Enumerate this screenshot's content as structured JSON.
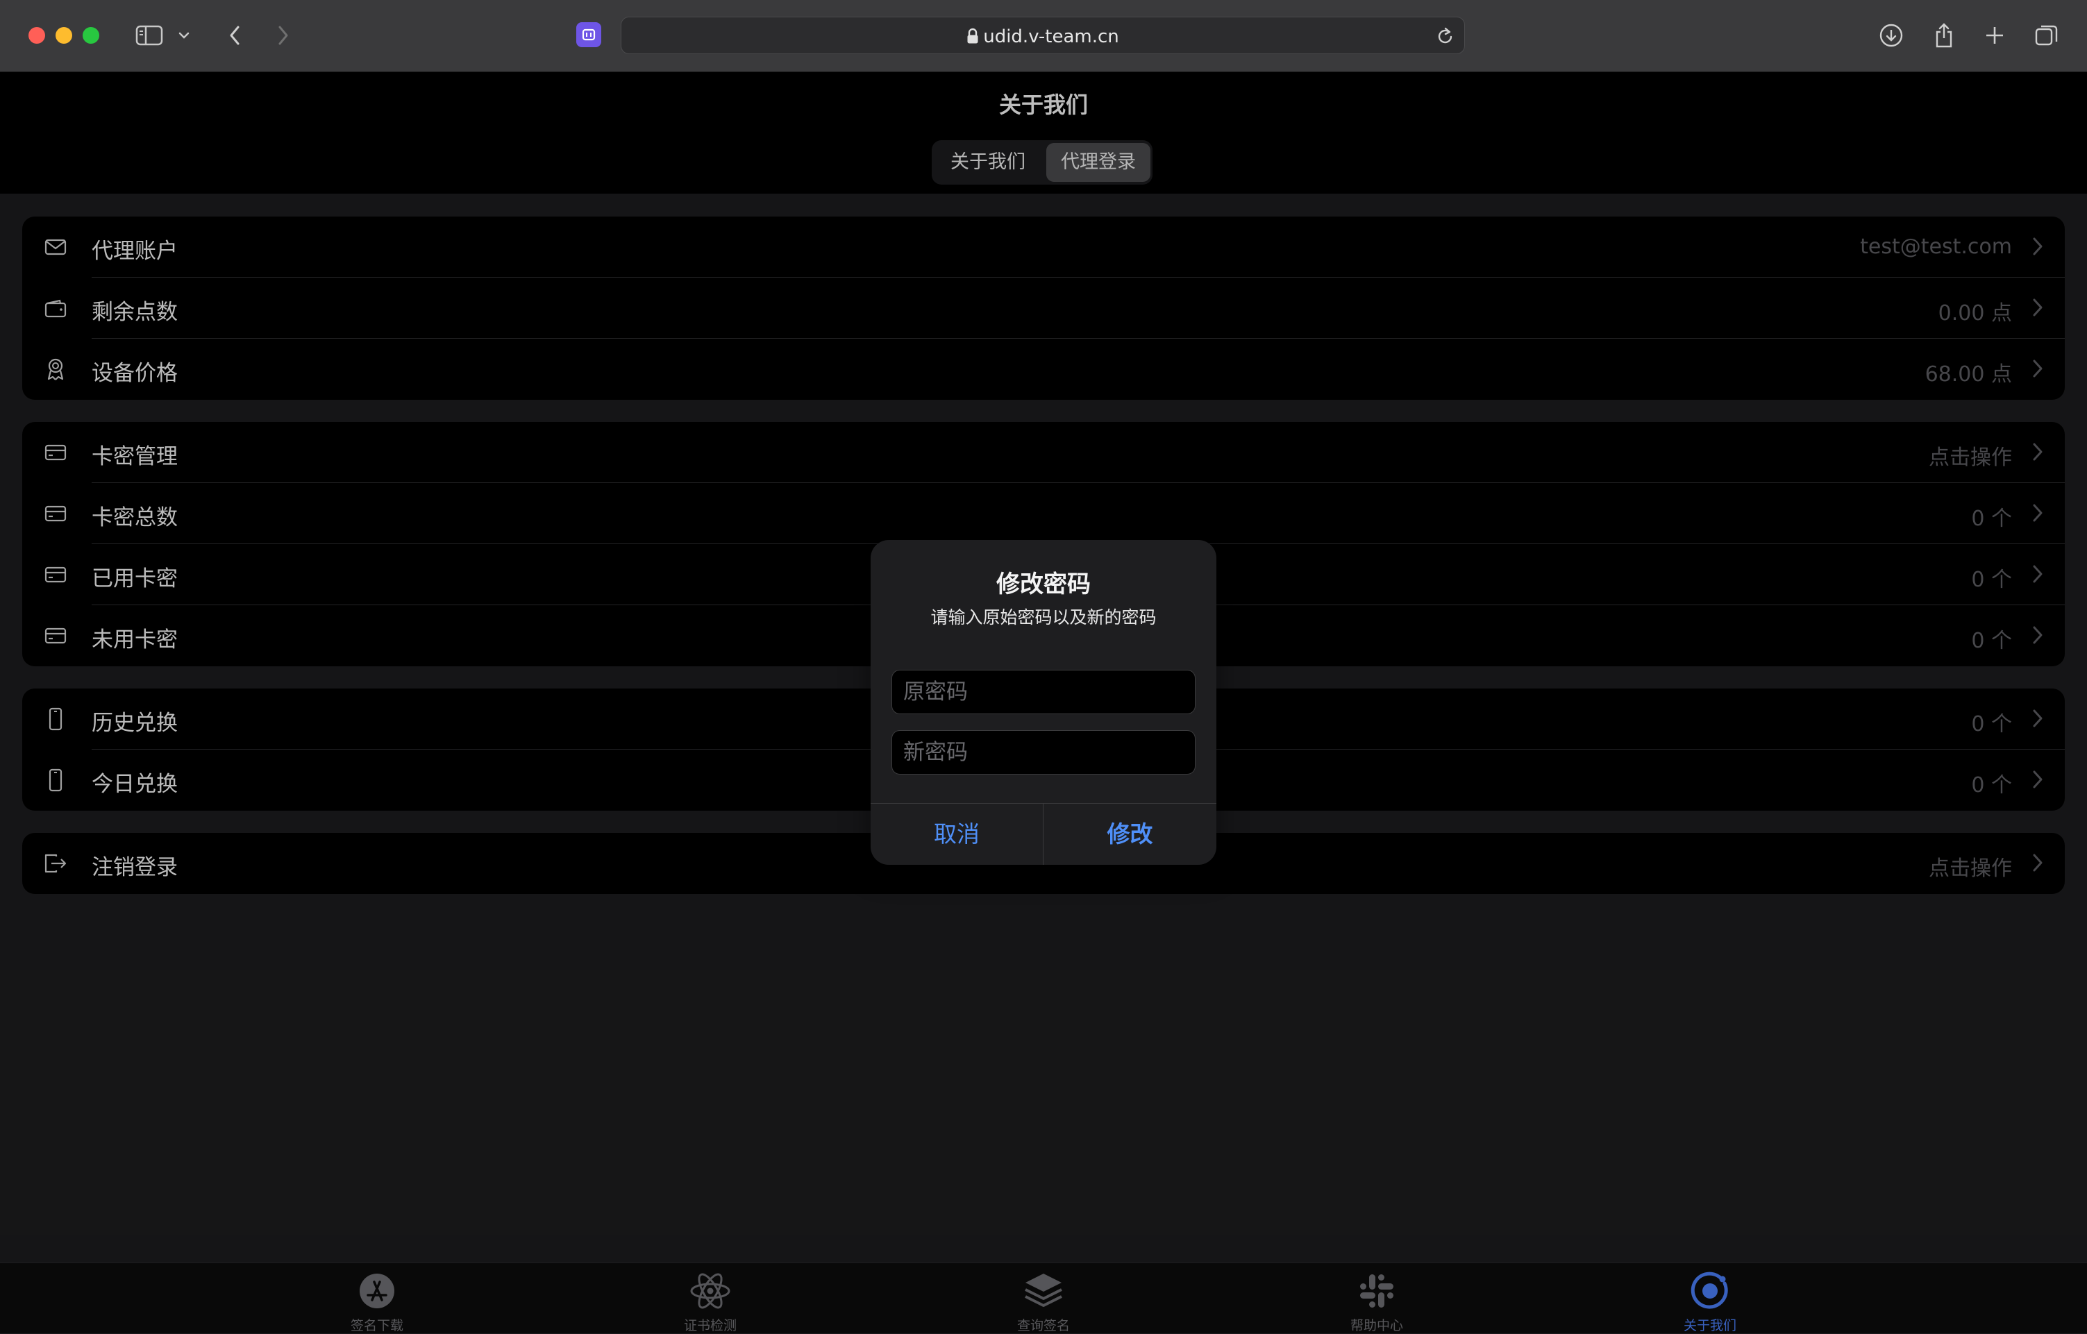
{
  "browser": {
    "url": "udid.v-team.cn"
  },
  "header": {
    "title": "关于我们",
    "segments": [
      "关于我们",
      "代理登录"
    ]
  },
  "groups": {
    "account": [
      {
        "label": "代理账户",
        "value": "test@test.com",
        "icon": "envelope-icon"
      },
      {
        "label": "剩余点数",
        "value": "0.00 点",
        "icon": "wallet-icon"
      },
      {
        "label": "设备价格",
        "value": "68.00 点",
        "icon": "award-icon"
      }
    ],
    "cards": [
      {
        "label": "卡密管理",
        "value": "点击操作",
        "icon": "card-icon"
      },
      {
        "label": "卡密总数",
        "value": "0 个",
        "icon": "card-icon"
      },
      {
        "label": "已用卡密",
        "value": "0 个",
        "icon": "card-icon"
      },
      {
        "label": "未用卡密",
        "value": "0 个",
        "icon": "card-icon"
      }
    ],
    "exchange": [
      {
        "label": "历史兑换",
        "value": "0 个",
        "icon": "phone-icon"
      },
      {
        "label": "今日兑换",
        "value": "0 个",
        "icon": "phone-icon"
      }
    ],
    "logout": [
      {
        "label": "注销登录",
        "value": "点击操作",
        "icon": "logout-icon"
      }
    ]
  },
  "dialog": {
    "title": "修改密码",
    "message": "请输入原始密码以及新的密码",
    "old_password_placeholder": "原密码",
    "new_password_placeholder": "新密码",
    "cancel_label": "取消",
    "confirm_label": "修改"
  },
  "tabbar": {
    "items": [
      {
        "label": "签名下载",
        "icon": "app-store-icon",
        "active": false
      },
      {
        "label": "证书检测",
        "icon": "atom-icon",
        "active": false
      },
      {
        "label": "查询签名",
        "icon": "layers-icon",
        "active": false
      },
      {
        "label": "帮助中心",
        "icon": "slack-icon",
        "active": false
      },
      {
        "label": "关于我们",
        "icon": "ionic-icon",
        "active": true
      }
    ],
    "active_color": "#4a7df5",
    "inactive_color": "#707074"
  },
  "colors": {
    "accent": "#4f8ff7",
    "background": "#1c1c1e"
  }
}
